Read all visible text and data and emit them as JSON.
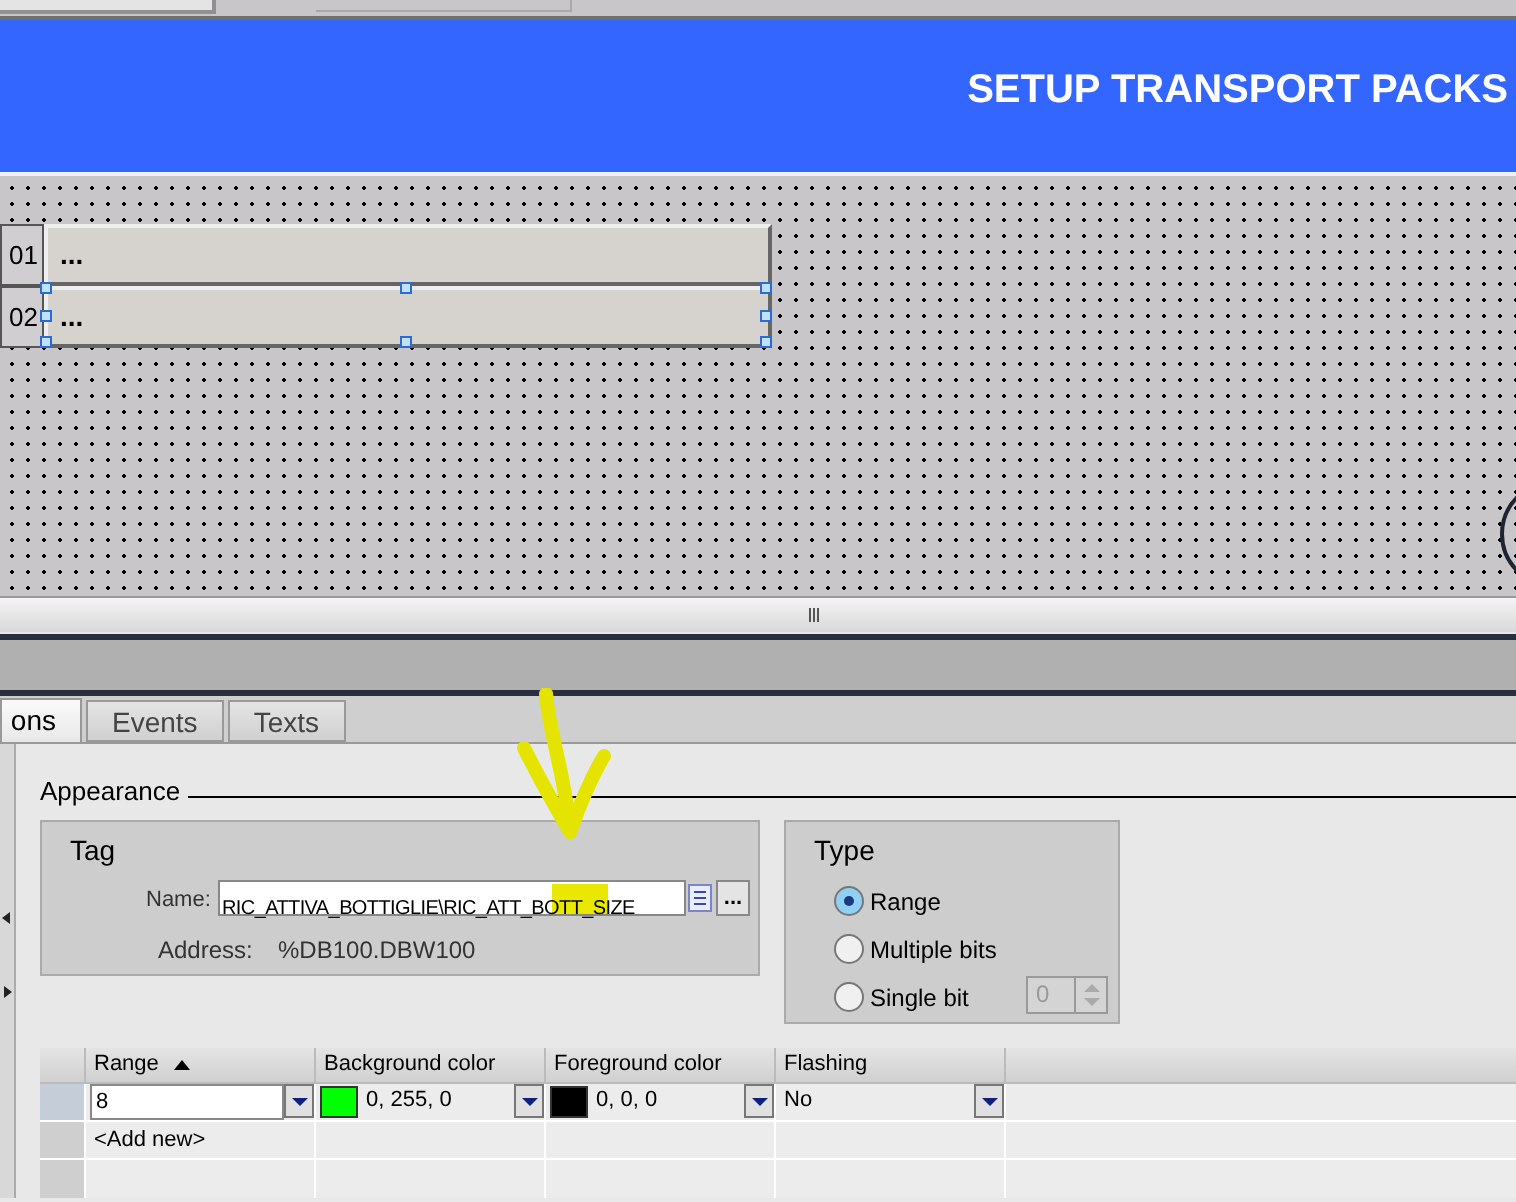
{
  "header": {
    "title": "SETUP TRANSPORT PACKS"
  },
  "canvas_rows": [
    {
      "label": "01",
      "value": "...",
      "selected": false
    },
    {
      "label": "02",
      "value": "...",
      "selected": true
    }
  ],
  "tabs": [
    {
      "label": "ons",
      "selected": true
    },
    {
      "label": "Events",
      "selected": false
    },
    {
      "label": "Texts",
      "selected": false
    }
  ],
  "section": {
    "title": "Appearance"
  },
  "tag": {
    "title": "Tag",
    "name_label": "Name:",
    "name_value": "RIC_ATTIVA_BOTTIGLIE\\RIC_ATT_BOTT_SIZE",
    "browse_label": "...",
    "address_label": "Address:",
    "address_value": "%DB100.DBW100"
  },
  "type": {
    "title": "Type",
    "options": [
      {
        "label": "Range",
        "selected": true
      },
      {
        "label": "Multiple bits",
        "selected": false
      },
      {
        "label": "Single bit",
        "selected": false
      }
    ],
    "bit_field": {
      "value": "0",
      "disabled": true
    }
  },
  "table": {
    "columns": [
      {
        "label": "Range",
        "sorted": true
      },
      {
        "label": "Background color",
        "sorted": false
      },
      {
        "label": "Foreground color",
        "sorted": false
      },
      {
        "label": "Flashing",
        "sorted": false
      }
    ],
    "rows": [
      {
        "range": "8",
        "background": {
          "color": "#00ff00",
          "text": "0, 255, 0"
        },
        "foreground": {
          "color": "#000000",
          "text": "0, 0, 0"
        },
        "flashing": "No"
      }
    ],
    "add_new": "<Add new>"
  }
}
